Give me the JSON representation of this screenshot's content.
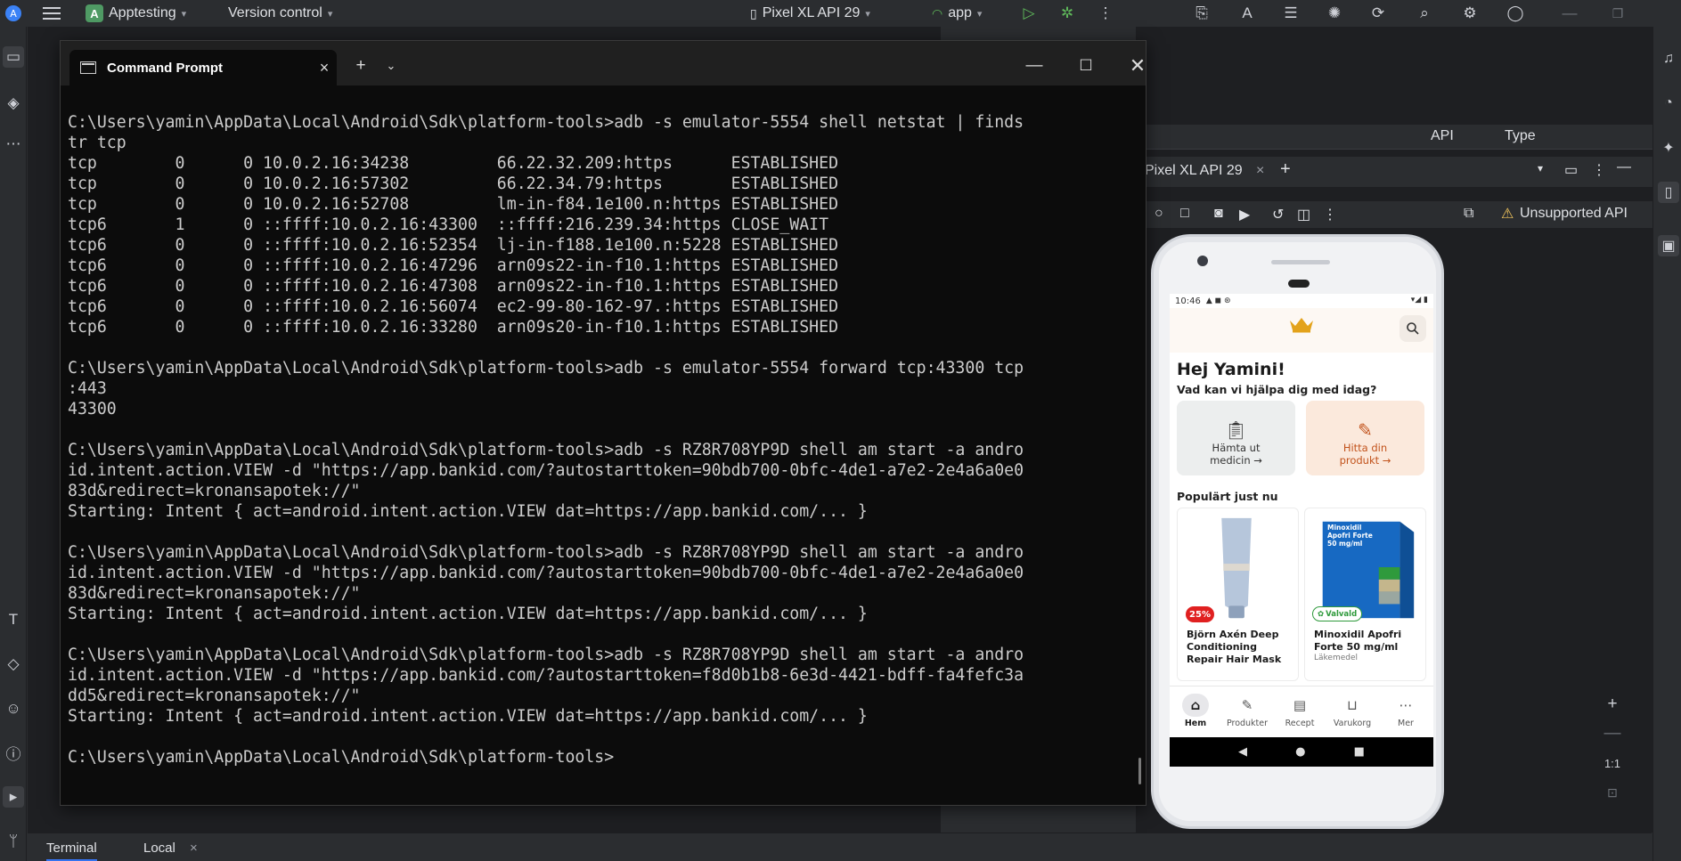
{
  "ide": {
    "project_badge": "A",
    "project_name": "Apptesting",
    "version_control": "Version control",
    "device_selector": "Pixel XL API 29",
    "run_config": "app",
    "device_manager": {
      "col_api": "API",
      "col_type": "Type"
    },
    "running_device_tab": "Pixel XL API 29",
    "unsupported_api": "Unsupported API",
    "bottom_tabs": {
      "terminal": "Terminal",
      "local": "Local"
    },
    "colors": {
      "accent": "#3574f0",
      "background": "#2b2d30"
    }
  },
  "cmd": {
    "tab_title": "Command Prompt",
    "lines": [
      "C:\\Users\\yamin\\AppData\\Local\\Android\\Sdk\\platform-tools>adb -s emulator-5554 shell netstat | finds",
      "tr tcp",
      "tcp        0      0 10.0.2.16:34238         66.22.32.209:https      ESTABLISHED",
      "tcp        0      0 10.0.2.16:57302         66.22.34.79:https       ESTABLISHED",
      "tcp        0      0 10.0.2.16:52708         lm-in-f84.1e100.n:https ESTABLISHED",
      "tcp6       1      0 ::ffff:10.0.2.16:43300  ::ffff:216.239.34:https CLOSE_WAIT",
      "tcp6       0      0 ::ffff:10.0.2.16:52354  lj-in-f188.1e100.n:5228 ESTABLISHED",
      "tcp6       0      0 ::ffff:10.0.2.16:47296  arn09s22-in-f10.1:https ESTABLISHED",
      "tcp6       0      0 ::ffff:10.0.2.16:47308  arn09s22-in-f10.1:https ESTABLISHED",
      "tcp6       0      0 ::ffff:10.0.2.16:56074  ec2-99-80-162-97.:https ESTABLISHED",
      "tcp6       0      0 ::ffff:10.0.2.16:33280  arn09s20-in-f10.1:https ESTABLISHED",
      "",
      "C:\\Users\\yamin\\AppData\\Local\\Android\\Sdk\\platform-tools>adb -s emulator-5554 forward tcp:43300 tcp",
      ":443",
      "43300",
      "",
      "C:\\Users\\yamin\\AppData\\Local\\Android\\Sdk\\platform-tools>adb -s RZ8R708YP9D shell am start -a andro",
      "id.intent.action.VIEW -d \"https://app.bankid.com/?autostarttoken=90bdb700-0bfc-4de1-a7e2-2e4a6a0e0",
      "83d&redirect=kronansapotek://\"",
      "Starting: Intent { act=android.intent.action.VIEW dat=https://app.bankid.com/... }",
      "",
      "C:\\Users\\yamin\\AppData\\Local\\Android\\Sdk\\platform-tools>adb -s RZ8R708YP9D shell am start -a andro",
      "id.intent.action.VIEW -d \"https://app.bankid.com/?autostarttoken=90bdb700-0bfc-4de1-a7e2-2e4a6a0e0",
      "83d&redirect=kronansapotek://\"",
      "Starting: Intent { act=android.intent.action.VIEW dat=https://app.bankid.com/... }",
      "",
      "C:\\Users\\yamin\\AppData\\Local\\Android\\Sdk\\platform-tools>adb -s RZ8R708YP9D shell am start -a andro",
      "id.intent.action.VIEW -d \"https://app.bankid.com/?autostarttoken=f8d0b1b8-6e3d-4421-bdff-fa4fefc3a",
      "dd5&redirect=kronansapotek://\"",
      "Starting: Intent { act=android.intent.action.VIEW dat=https://app.bankid.com/... }",
      "",
      "C:\\Users\\yamin\\AppData\\Local\\Android\\Sdk\\platform-tools>"
    ]
  },
  "phone": {
    "status_time": "10:46",
    "greeting": "Hej Yamini!",
    "help_question": "Vad kan vi hjälpa dig med idag?",
    "card_medicin": {
      "line1": "Hämta ut",
      "line2": "medicin →"
    },
    "card_produkt": {
      "line1": "Hitta din",
      "line2": "produkt →"
    },
    "popular_title": "Populärt just nu",
    "products": [
      {
        "name": "Björn Axén Deep Conditioning Repair Hair Mask",
        "badge": "25%"
      },
      {
        "name": "Minoxidil Apofri Forte 50 mg/ml",
        "badge": "Valvald",
        "sub": "Läkemedel",
        "box_title": "Minoxidil Apofri Forte 50 mg/ml"
      }
    ],
    "nav": [
      "Hem",
      "Produkter",
      "Recept",
      "Varukorg",
      "Mer"
    ],
    "colors": {
      "crown": "#e3a21a",
      "produkt_card": "#fbe9dc",
      "produkt_text": "#c2531c",
      "sale_badge": "#e02020",
      "valvald": "#2f9a3c"
    }
  }
}
